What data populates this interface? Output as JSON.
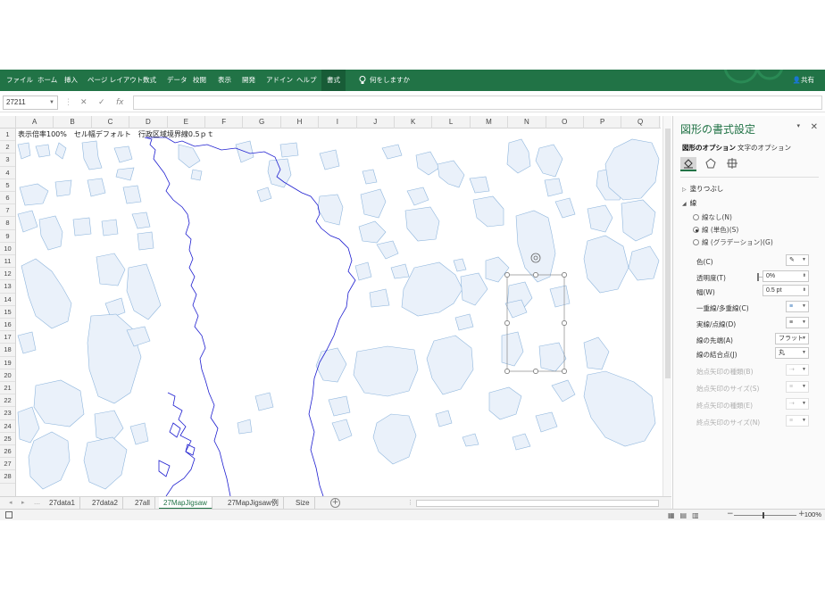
{
  "ribbon": {
    "tabs": [
      "ファイル",
      "ホーム",
      "挿入",
      "ページ レイアウト",
      "数式",
      "データ",
      "校閲",
      "表示",
      "開発",
      "アドイン",
      "ヘルプ"
    ],
    "active_tab": "書式",
    "tell_me": "何をしますか",
    "share": "共有",
    "color": "#217346"
  },
  "formula_bar": {
    "name_box": "27211",
    "cancel": "✕",
    "enter": "✓",
    "fx": "fx",
    "formula": ""
  },
  "grid": {
    "columns": [
      "A",
      "B",
      "C",
      "D",
      "E",
      "F",
      "G",
      "H",
      "I",
      "J",
      "K",
      "L",
      "M",
      "N",
      "O",
      "P",
      "Q"
    ],
    "rows": [
      "1",
      "2",
      "3",
      "4",
      "5",
      "6",
      "7",
      "8",
      "9",
      "10",
      "11",
      "12",
      "13",
      "14",
      "15",
      "16",
      "17",
      "18",
      "19",
      "20",
      "21",
      "22",
      "23",
      "24",
      "25",
      "26",
      "27",
      "28"
    ],
    "cell_a1": "表示倍率100%　セル幅デフォルト　行政区域境界線0.5ｐｔ",
    "shape_fill": "#eaf1fa",
    "shape_stroke": "#8fb6dd",
    "boundary_color": "#1f1fd0"
  },
  "sheet_tabs": {
    "tabs": [
      "27data1",
      "27data2",
      "27all",
      "27MapJigsaw",
      "27MapJigsaw例",
      "Size"
    ],
    "active": "27MapJigsaw"
  },
  "status": {
    "zoom": "100%",
    "zoom_minus": "−",
    "zoom_plus": "+"
  },
  "pane": {
    "title": "図形の書式設定",
    "close": "✕",
    "menu": "▾",
    "tab_shape": "図形のオプション",
    "tab_text": "文字のオプション",
    "fill_section": "塗りつぶし",
    "line_section": "線",
    "radios": [
      "線なし(N)",
      "線 (単色)(S)",
      "線 (グラデーション)(G)"
    ],
    "color_label": "色(C)",
    "transparency_label": "透明度(T)",
    "transparency_value": "0%",
    "width_label": "幅(W)",
    "width_value": "0.5 pt",
    "compound_label": "一重線/多重線(C)",
    "dash_label": "実線/点線(D)",
    "cap_label": "線の先端(A)",
    "cap_value": "フラット",
    "join_label": "線の結合点(J)",
    "join_value": "丸",
    "begin_arrow_type": "始点矢印の種類(B)",
    "begin_arrow_size": "始点矢印のサイズ(S)",
    "end_arrow_type": "終点矢印の種類(E)",
    "end_arrow_size": "終点矢印のサイズ(N)"
  }
}
